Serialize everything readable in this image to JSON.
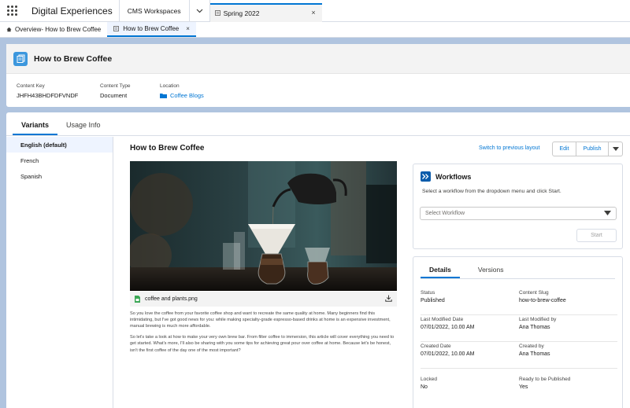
{
  "app": {
    "name": "Digital Experiences",
    "nav_item": "CMS Workspaces",
    "top_tab": "Spring 2022"
  },
  "subtabs": [
    {
      "label": "Overview- How to Brew Coffee"
    },
    {
      "label": "How to Brew Coffee"
    }
  ],
  "record": {
    "title": "How to Brew Coffee",
    "fields": {
      "content_key_label": "Content Key",
      "content_key_value": "JHFH43BHDFDFVNDF",
      "content_type_label": "Content Type",
      "content_type_value": "Document",
      "location_label": "Location",
      "location_value": "Coffee Blogs"
    }
  },
  "main_tabs": {
    "variants": "Variants",
    "usage_info": "Usage Info"
  },
  "variants": [
    {
      "label": "English (default)"
    },
    {
      "label": "French"
    },
    {
      "label": "Spanish"
    }
  ],
  "content": {
    "title": "How to Brew Coffee",
    "switch_link": "Switch to previous layout",
    "edit_label": "Edit",
    "publish_label": "Publish",
    "file_name": "coffee and plants.png",
    "paragraph_1": "So you love the coffee from your favorite coffee shop and want to recreate the same quality at home. Many beginners find this intimidating, but I've got good news for you: while making specialty-grade espresso-based drinks at home is an expensive investment, manual brewing is much more affordable.",
    "paragraph_2": "So let's take a look at how to make your very own brew bar. From filter coffee to immersion, this article will cover everything you need to get started. What's more, I'll also be sharing with you some tips for achieving great pour over coffee at home. Because let's be honest, isn't the first coffee of the day one of the most important?"
  },
  "workflows": {
    "title": "Workflows",
    "description": "Select a workflow from the dropdown menu and click Start.",
    "select_placeholder": "Select Workflow",
    "start_label": "Start"
  },
  "details": {
    "tab_details": "Details",
    "tab_versions": "Versions",
    "status_label": "Status",
    "status_value": "Published",
    "slug_label": "Content Slug",
    "slug_value": "how-to-brew-coffee",
    "last_modified_date_label": "Last Modified Date",
    "last_modified_date_value": "07/01/2022, 10.00 AM",
    "last_modified_by_label": "Last Modified by",
    "last_modified_by_value": "Ana Thomas",
    "created_date_label": "Created Date",
    "created_date_value": "07/01/2022, 10.00 AM",
    "created_by_label": "Created by",
    "created_by_value": "Ana Thomas",
    "locked_label": "Locked",
    "locked_value": "No",
    "ready_label": "Ready to be Published",
    "ready_value": "Yes"
  },
  "colors": {
    "accent": "#0176d3",
    "workspace_bg": "#b0c4df",
    "record_icon": "#3c97dd",
    "workflow_icon": "#0b5cab"
  }
}
